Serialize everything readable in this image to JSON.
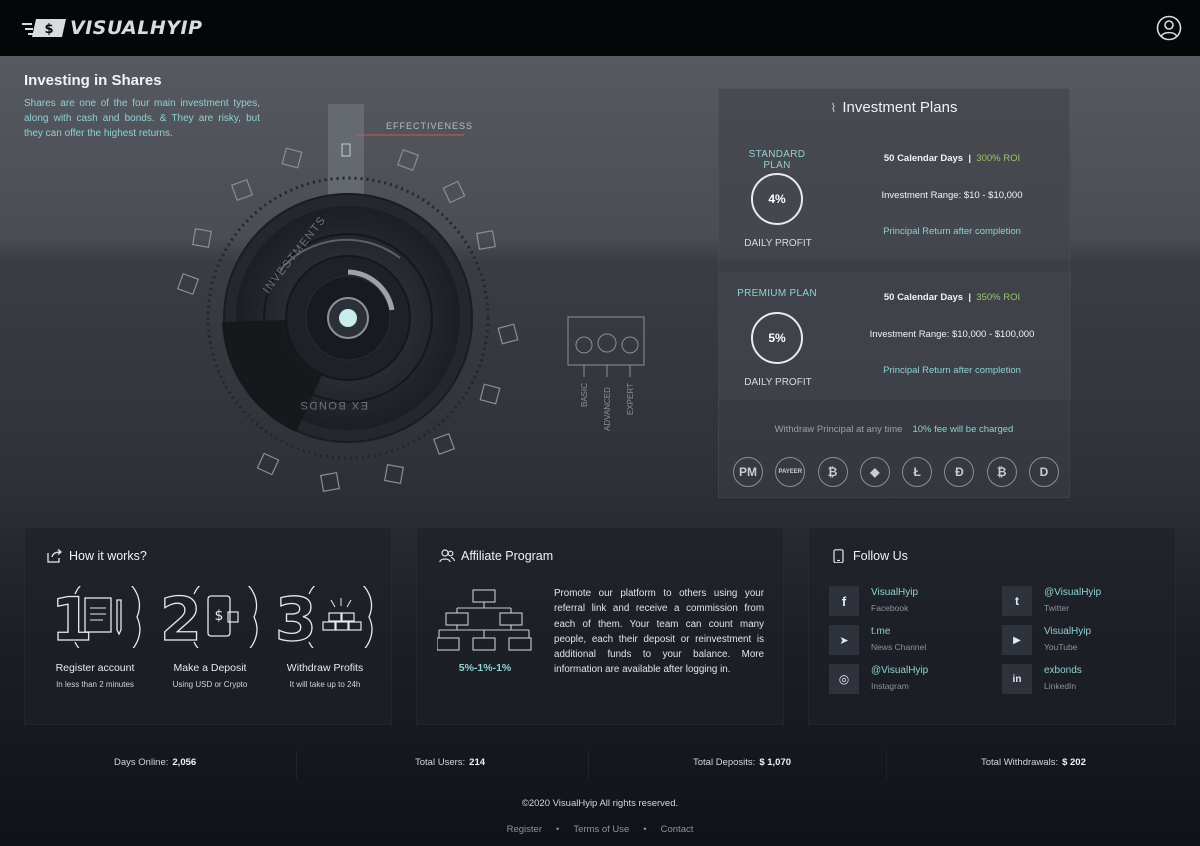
{
  "header": {
    "brand": "VISUALHYIP",
    "logo_mark_text": "$"
  },
  "hero": {
    "title": "Investing in Shares",
    "text": "Shares are one of the four main investment types, along with cash and bonds. & They are risky, but they can offer the highest returns.",
    "effectiveness_label": "EFFECTIVENESS",
    "ring_labels": [
      "INVESTMENTS",
      "EX BONDS"
    ],
    "levels": [
      "BASIC",
      "ADVANCED",
      "EXPERT"
    ]
  },
  "plans": {
    "title": "Investment Plans",
    "items": [
      {
        "name": "STANDARD PLAN",
        "daily_rate": "4%",
        "daily_label": "DAILY PROFIT",
        "days": "50 Calendar Days",
        "roi": "300% ROI",
        "range": "Investment Range: $10 - $10,000",
        "return_note": "Principal Return after completion"
      },
      {
        "name": "PREMIUM PLAN",
        "daily_rate": "5%",
        "daily_label": "DAILY PROFIT",
        "days": "50 Calendar Days",
        "roi": "350% ROI",
        "range": "Investment Range: $10,000 - $100,000",
        "return_note": "Principal Return after completion"
      }
    ],
    "withdraw_note": "Withdraw Principal at any time",
    "fee_note": "10% fee will be charged",
    "payment_icons": [
      {
        "name": "perfect-money-icon",
        "glyph": "PM"
      },
      {
        "name": "payeer-icon",
        "glyph": "PAYEER"
      },
      {
        "name": "bitcoin-icon",
        "glyph": "₿"
      },
      {
        "name": "ethereum-icon",
        "glyph": "◆"
      },
      {
        "name": "litecoin-icon",
        "glyph": "Ł"
      },
      {
        "name": "dogecoin-icon",
        "glyph": "Ð"
      },
      {
        "name": "bitcoin-cash-icon",
        "glyph": "₿"
      },
      {
        "name": "dash-icon",
        "glyph": "D"
      }
    ]
  },
  "how": {
    "title": "How it works?",
    "steps": [
      {
        "number": "1",
        "label": "Register account",
        "sub": "In less than 2 minutes"
      },
      {
        "number": "2",
        "label": "Make a Deposit",
        "sub": "Using USD or Crypto"
      },
      {
        "number": "3",
        "label": "Withdraw Profits",
        "sub": "It will take up to 24h"
      }
    ]
  },
  "affiliate": {
    "title": "Affiliate Program",
    "rates": "5%-1%-1%",
    "text": "Promote our platform to others using your referral link and receive a commission from each of them. Your team can count many people, each their deposit or reinvestment is additional funds to your balance. More information are available after logging in."
  },
  "follow": {
    "title": "Follow Us",
    "items": [
      {
        "name": "VisualHyip",
        "network": "Facebook",
        "glyph": "f"
      },
      {
        "name": "@VisualHyip",
        "network": "Twitter",
        "glyph": "t"
      },
      {
        "name": "t.me",
        "network": "News Channel",
        "glyph": "➤"
      },
      {
        "name": "VisualHyip",
        "network": "YouTube",
        "glyph": "▶"
      },
      {
        "name": "@VisualHyip",
        "network": "Instagram",
        "glyph": "◎"
      },
      {
        "name": "exbonds",
        "network": "LinkedIn",
        "glyph": "in"
      }
    ]
  },
  "stats": {
    "days_label": "Days Online:",
    "days_value": "2,056",
    "users_label": "Total Users:",
    "users_value": "214",
    "deposits_label": "Total Deposits:",
    "deposits_value": "$ 1,070",
    "withdrawals_label": "Total Withdrawals:",
    "withdrawals_value": "$ 202"
  },
  "footer": {
    "copyright": "©2020 VisualHyip All rights reserved.",
    "links": [
      "Register",
      "Terms of Use",
      "Contact"
    ]
  },
  "colors": {
    "accent_teal": "#8fd2d2",
    "roi_green": "#9bc46c",
    "header_bg": "#050608"
  }
}
